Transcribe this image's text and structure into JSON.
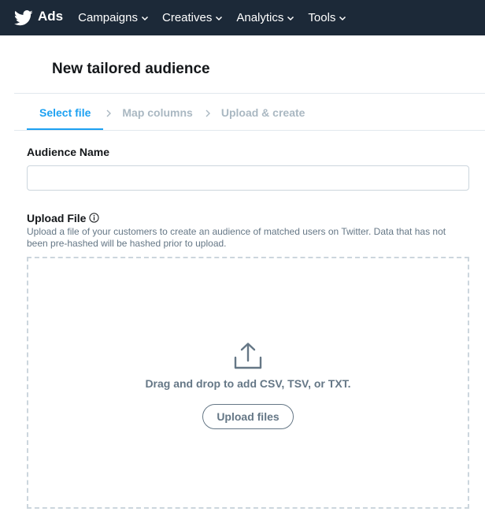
{
  "topbar": {
    "brand_text": "Ads",
    "nav": [
      {
        "label": "Campaigns"
      },
      {
        "label": "Creatives"
      },
      {
        "label": "Analytics"
      },
      {
        "label": "Tools"
      }
    ]
  },
  "page": {
    "title": "New tailored audience"
  },
  "stepper": {
    "steps": [
      {
        "label": "Select file",
        "active": true
      },
      {
        "label": "Map columns",
        "active": false
      },
      {
        "label": "Upload & create",
        "active": false
      }
    ]
  },
  "form": {
    "audience_name_label": "Audience Name",
    "audience_name_value": "",
    "upload_file_label": "Upload File",
    "upload_help": "Upload a file of your customers to create an audience of matched users on Twitter. Data that has not been pre-hashed will be hashed prior to upload.",
    "dropzone_text": "Drag and drop to add CSV, TSV, or TXT.",
    "upload_button": "Upload files"
  },
  "colors": {
    "nav_bg": "#1c2938",
    "accent": "#1da1f2",
    "muted": "#657786",
    "inactive_step": "#aab8c2"
  }
}
